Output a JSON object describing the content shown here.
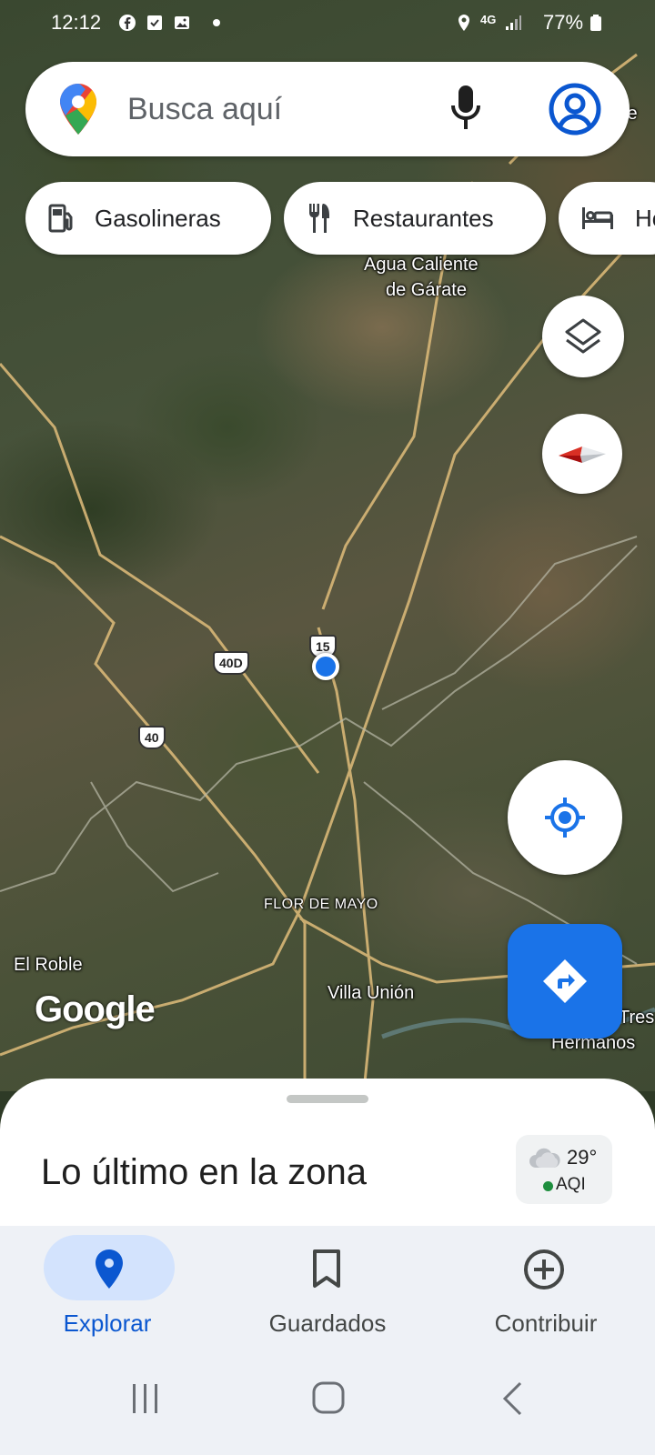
{
  "status_bar": {
    "time": "12:12",
    "network": "4G",
    "battery": "77%"
  },
  "search": {
    "placeholder": "Busca aquí"
  },
  "chips": {
    "gas": "Gasolineras",
    "restaurants": "Restaurantes",
    "hotels": "Ho"
  },
  "map": {
    "labels": {
      "agua_caliente_1": "Agua Caliente",
      "agua_caliente_2": "de Gárate",
      "flor_de_mayo": "FLOR DE MAYO",
      "el_roble": "El Roble",
      "villa_union": "Villa Unión",
      "tres": "Tres",
      "hermanos": "Hermanos",
      "edge_te": "te"
    },
    "shields": {
      "hwy15": "15",
      "hwy40d": "40D",
      "hwy40": "40"
    },
    "logo": "Google"
  },
  "sheet": {
    "title": "Lo último en la zona",
    "temperature": "29°",
    "aqi": "AQI"
  },
  "nav": {
    "explore": "Explorar",
    "saved": "Guardados",
    "contribute": "Contribuir"
  },
  "colors": {
    "accent": "#1a73e8",
    "active_nav": "#0b57d0",
    "aqi_good": "#1e8e3e"
  }
}
